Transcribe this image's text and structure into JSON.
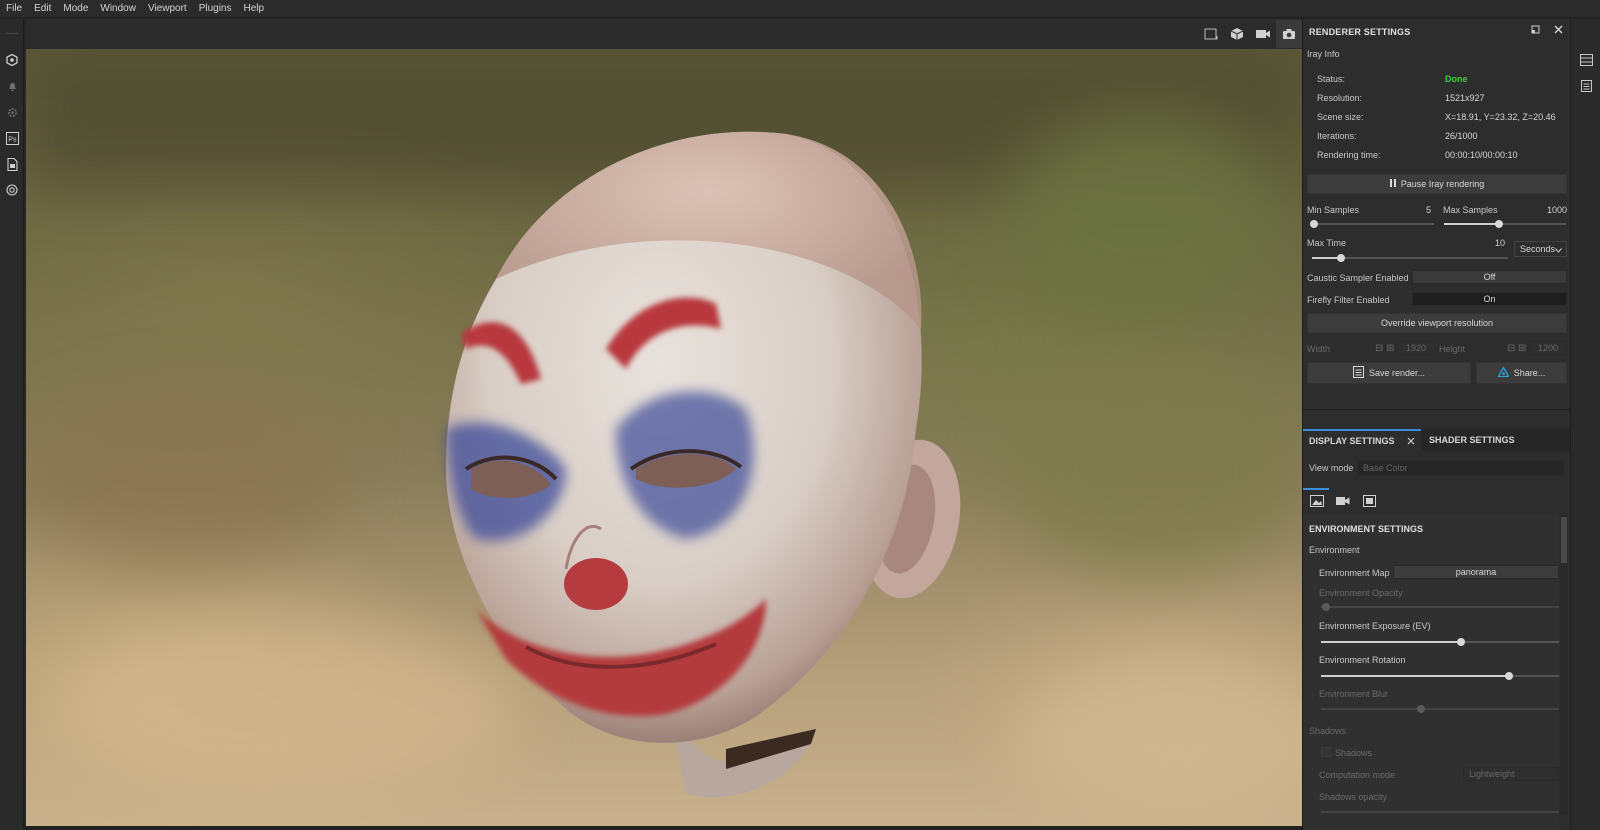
{
  "menu": [
    "File",
    "Edit",
    "Mode",
    "Window",
    "Viewport",
    "Plugins",
    "Help"
  ],
  "left_toolbar": [
    {
      "icon": "hexagon-gear-icon"
    },
    {
      "icon": "bell-icon"
    },
    {
      "icon": "cog-icon"
    },
    {
      "icon": "photoshop-icon",
      "text": "Ps"
    },
    {
      "icon": "document-icon"
    },
    {
      "icon": "settings-circle-icon"
    }
  ],
  "viewport_icons": [
    "frame-icon",
    "cube-icon",
    "camera-video-icon",
    "screenshot-camera-icon"
  ],
  "renderer": {
    "title": "RENDERER SETTINGS",
    "section": "Iray Info",
    "status_label": "Status:",
    "status_value": "Done",
    "resolution_label": "Resolution:",
    "resolution_value": "1521x927",
    "scene_size_label": "Scene size:",
    "scene_size_value": "X=18.91, Y=23.32, Z=20.46",
    "iterations_label": "Iterations:",
    "iterations_value": "26/1000",
    "render_time_label": "Rendering time:",
    "render_time_value": "00:00:10/00:00:10",
    "pause_button": "Pause Iray rendering",
    "min_samples_label": "Min Samples",
    "min_samples_value": "5",
    "min_samples_level": 0.02,
    "max_samples_label": "Max Samples",
    "max_samples_value": "1000",
    "max_samples_level": 0.45,
    "max_time_label": "Max Time",
    "max_time_value": "10",
    "max_time_level": 0.15,
    "time_unit": "Seconds",
    "caustic_label": "Caustic Sampler Enabled",
    "caustic_value": "Off",
    "firefly_label": "Firefly Filter Enabled",
    "firefly_value": "On",
    "override_button": "Override viewport resolution",
    "width_label": "Width",
    "width_value": "1920",
    "height_label": "Height",
    "height_value": "1200",
    "save_button": "Save render...",
    "share_button": "Share..."
  },
  "display": {
    "tab_display": "DISPLAY SETTINGS",
    "tab_shader": "SHADER SETTINGS",
    "view_mode_label": "View mode",
    "view_mode_placeholder": "Base Color"
  },
  "environment": {
    "title": "ENVIRONMENT SETTINGS",
    "group": "Environment",
    "map_label": "Environment Map",
    "map_value": "panorama",
    "opacity_label": "Environment Opacity",
    "opacity_level": 0.02,
    "exposure_label": "Environment Exposure (EV)",
    "exposure_level": 0.59,
    "rotation_label": "Environment Rotation",
    "rotation_level": 0.79,
    "blur_label": "Environment Blur",
    "blur_level": 0.42,
    "shadows_group": "Shadows",
    "shadows_check": "Shadows",
    "computation_label": "Computation mode",
    "computation_value": "Lightweight",
    "shadows_opacity_label": "Shadows opacity"
  }
}
